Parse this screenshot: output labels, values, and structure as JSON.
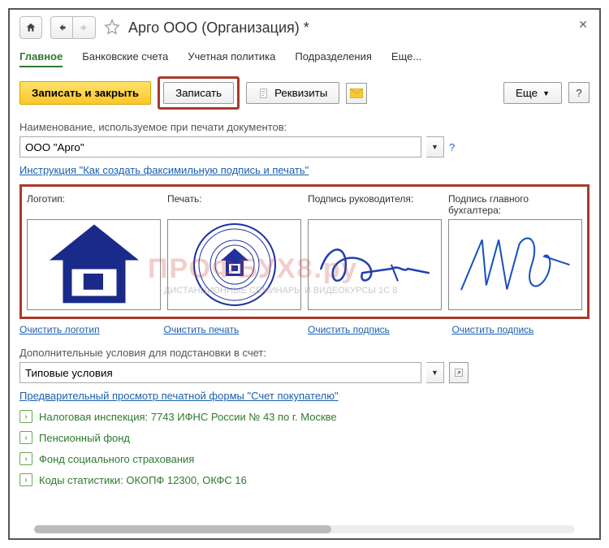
{
  "title": "Арго ООО (Организация) *",
  "tabs": {
    "main": "Главное",
    "bank": "Банковские счета",
    "policy": "Учетная политика",
    "divisions": "Подразделения",
    "more": "Еще..."
  },
  "toolbar": {
    "save_close": "Записать и закрыть",
    "save": "Записать",
    "details": "Реквизиты",
    "more_btn": "Еще"
  },
  "naming": {
    "label": "Наименование, используемое при печати документов:",
    "value": "ООО \"Арго\""
  },
  "instruction_link": "Инструкция \"Как создать факсимильную подпись и печать\"",
  "sig": {
    "logo_lbl": "Логотип:",
    "stamp_lbl": "Печать:",
    "dir_lbl": "Подпись руководителя:",
    "acc_lbl": "Подпись главного бухгалтера:",
    "clear_logo": "Очистить логотип",
    "clear_stamp": "Очистить печать",
    "clear_sig1": "Очистить подпись",
    "clear_sig2": "Очистить подпись"
  },
  "additional": {
    "label": "Дополнительные условия для подстановки в счет:",
    "value": "Типовые условия"
  },
  "preview_link": "Предварительный просмотр печатной формы \"Счет покупателю\"",
  "exp": {
    "tax": "Налоговая инспекция: 7743 ИФНС России № 43 по г. Москве",
    "pension": "Пенсионный фонд",
    "social": "Фонд социального страхования",
    "stat": "Коды статистики: ОКОПФ 12300, ОКФС 16"
  },
  "watermark": "ПРОФБУХ8.ру",
  "watermark_sub": "ДИСТАНЦИОННЫЕ СЕМИНАРЫ И ВИДЕОКУРСЫ 1С 8"
}
